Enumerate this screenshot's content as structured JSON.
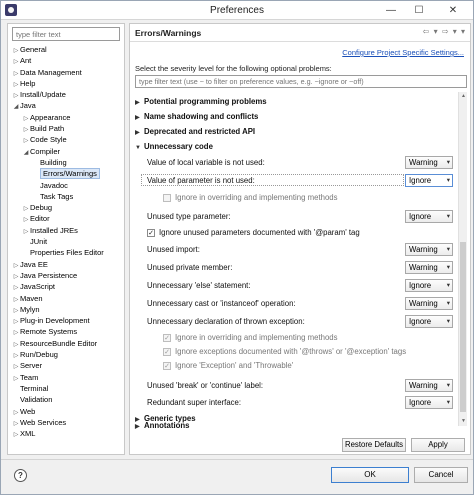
{
  "window": {
    "title": "Preferences",
    "minimize": "—",
    "maximize": "☐",
    "close": "✕"
  },
  "left": {
    "filter_placeholder": "type filter text",
    "tree": [
      {
        "label": "General",
        "level": 0,
        "arrow": "▷"
      },
      {
        "label": "Ant",
        "level": 0,
        "arrow": "▷"
      },
      {
        "label": "Data Management",
        "level": 0,
        "arrow": "▷"
      },
      {
        "label": "Help",
        "level": 0,
        "arrow": "▷"
      },
      {
        "label": "Install/Update",
        "level": 0,
        "arrow": "▷"
      },
      {
        "label": "Java",
        "level": 0,
        "arrow": "◢"
      },
      {
        "label": "Appearance",
        "level": 1,
        "arrow": "▷"
      },
      {
        "label": "Build Path",
        "level": 1,
        "arrow": "▷"
      },
      {
        "label": "Code Style",
        "level": 1,
        "arrow": "▷"
      },
      {
        "label": "Compiler",
        "level": 1,
        "arrow": "◢"
      },
      {
        "label": "Building",
        "level": 2,
        "arrow": ""
      },
      {
        "label": "Errors/Warnings",
        "level": 2,
        "arrow": "",
        "selected": true
      },
      {
        "label": "Javadoc",
        "level": 2,
        "arrow": ""
      },
      {
        "label": "Task Tags",
        "level": 2,
        "arrow": ""
      },
      {
        "label": "Debug",
        "level": 1,
        "arrow": "▷"
      },
      {
        "label": "Editor",
        "level": 1,
        "arrow": "▷"
      },
      {
        "label": "Installed JREs",
        "level": 1,
        "arrow": "▷"
      },
      {
        "label": "JUnit",
        "level": 1,
        "arrow": ""
      },
      {
        "label": "Properties Files Editor",
        "level": 1,
        "arrow": ""
      },
      {
        "label": "Java EE",
        "level": 0,
        "arrow": "▷"
      },
      {
        "label": "Java Persistence",
        "level": 0,
        "arrow": "▷"
      },
      {
        "label": "JavaScript",
        "level": 0,
        "arrow": "▷"
      },
      {
        "label": "Maven",
        "level": 0,
        "arrow": "▷"
      },
      {
        "label": "Mylyn",
        "level": 0,
        "arrow": "▷"
      },
      {
        "label": "Plug-in Development",
        "level": 0,
        "arrow": "▷"
      },
      {
        "label": "Remote Systems",
        "level": 0,
        "arrow": "▷"
      },
      {
        "label": "ResourceBundle Editor",
        "level": 0,
        "arrow": "▷"
      },
      {
        "label": "Run/Debug",
        "level": 0,
        "arrow": "▷"
      },
      {
        "label": "Server",
        "level": 0,
        "arrow": "▷"
      },
      {
        "label": "Team",
        "level": 0,
        "arrow": "▷"
      },
      {
        "label": "Terminal",
        "level": 0,
        "arrow": ""
      },
      {
        "label": "Validation",
        "level": 0,
        "arrow": ""
      },
      {
        "label": "Web",
        "level": 0,
        "arrow": "▷"
      },
      {
        "label": "Web Services",
        "level": 0,
        "arrow": "▷"
      },
      {
        "label": "XML",
        "level": 0,
        "arrow": "▷"
      }
    ]
  },
  "right": {
    "title": "Errors/Warnings",
    "nav": "⇦ ▾ ⇨ ▾ ▾",
    "config_link": "Configure Project Specific Settings...",
    "description": "Select the severity level for the following optional problems:",
    "filter_placeholder": "type filter text (use ~ to filter on preference values, e.g. ~ignore or ~off)",
    "sections": {
      "potential": "Potential programming problems",
      "name_shadow": "Name shadowing and conflicts",
      "deprecated": "Deprecated and restricted API",
      "unnecessary": "Unnecessary code",
      "generic": "Generic types",
      "annotations": "Annotations"
    },
    "options": {
      "local_var": {
        "label": "Value of local variable is not used:",
        "value": "Warning"
      },
      "param": {
        "label": "Value of parameter is not used:",
        "value": "Ignore"
      },
      "param_override": {
        "label": "Ignore in overriding and implementing methods"
      },
      "unused_type_param": {
        "label": "Unused type parameter:",
        "value": "Ignore"
      },
      "ignore_param_doc": {
        "label": "Ignore unused parameters documented with '@param' tag"
      },
      "unused_import": {
        "label": "Unused import:",
        "value": "Warning"
      },
      "unused_private": {
        "label": "Unused private member:",
        "value": "Warning"
      },
      "unnecessary_else": {
        "label": "Unnecessary 'else' statement:",
        "value": "Ignore"
      },
      "unnecessary_cast": {
        "label": "Unnecessary cast or 'instanceof' operation:",
        "value": "Warning"
      },
      "thrown_exception": {
        "label": "Unnecessary declaration of thrown exception:",
        "value": "Ignore"
      },
      "thrown_override": {
        "label": "Ignore in overriding and implementing methods"
      },
      "thrown_doc": {
        "label": "Ignore exceptions documented with '@throws' or '@exception' tags"
      },
      "thrown_exc": {
        "label": "Ignore 'Exception' and 'Throwable'"
      },
      "unused_break": {
        "label": "Unused 'break' or 'continue' label:",
        "value": "Warning"
      },
      "redundant_super": {
        "label": "Redundant super interface:",
        "value": "Ignore"
      }
    },
    "restore_defaults": "Restore Defaults",
    "apply": "Apply"
  },
  "footer": {
    "help": "?",
    "ok": "OK",
    "cancel": "Cancel"
  },
  "icons": {
    "section_collapsed": "▶",
    "section_expanded": "▼",
    "chevron": "▾",
    "check": "✓"
  }
}
